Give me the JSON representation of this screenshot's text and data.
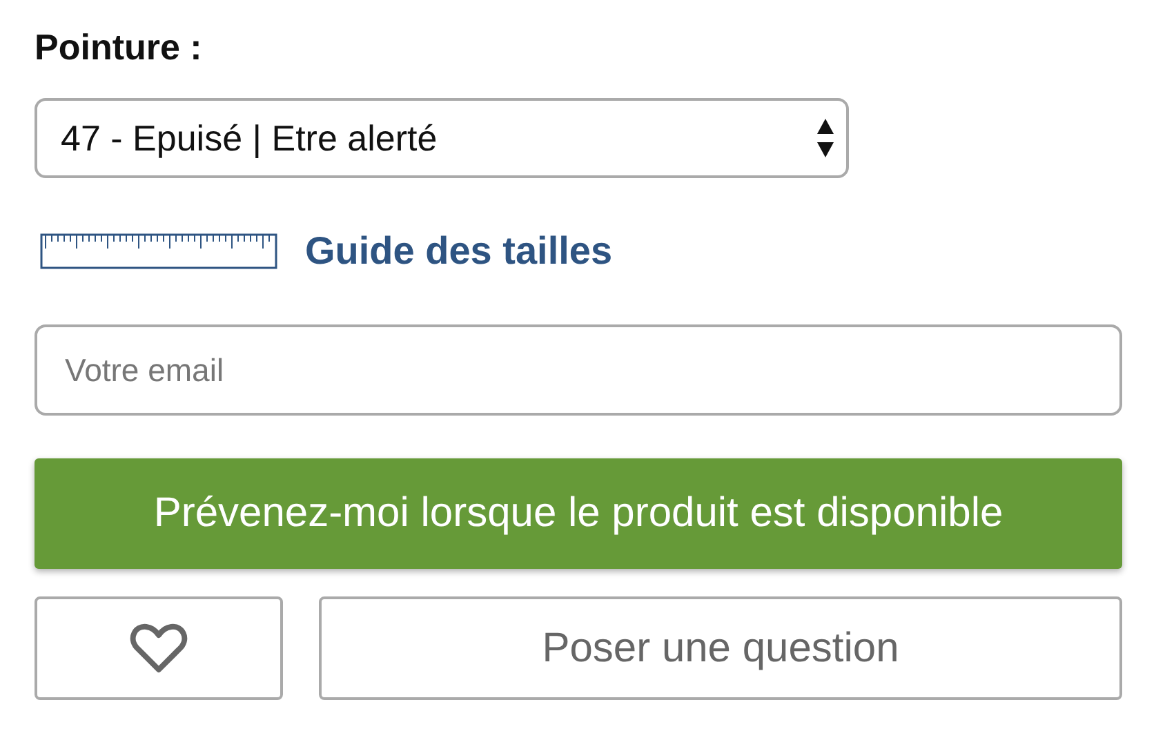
{
  "size_label": "Pointure :",
  "size_select": {
    "value": "47 - Epuisé | Etre alerté"
  },
  "size_guide_link": "Guide des tailles",
  "email_field": {
    "placeholder": "Votre email"
  },
  "notify_button": "Prévenez-moi lorsque le produit est disponible",
  "ask_button": "Poser une question"
}
